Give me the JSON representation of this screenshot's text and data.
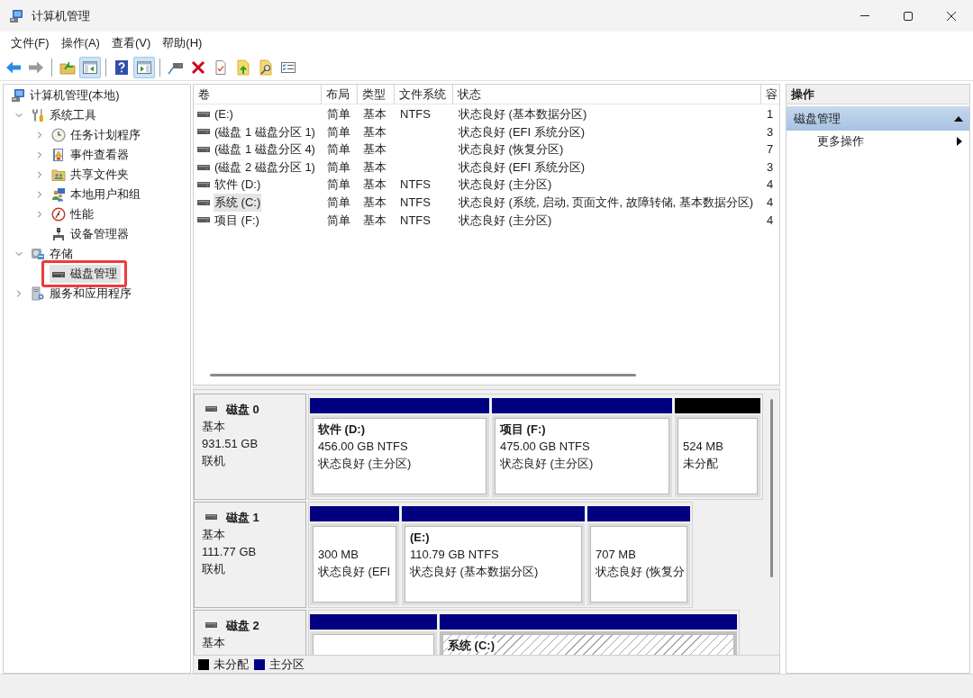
{
  "window": {
    "title": "计算机管理"
  },
  "menu": [
    "文件(F)",
    "操作(A)",
    "查看(V)",
    "帮助(H)"
  ],
  "toolbar": [
    {
      "buttons": [
        {
          "kind": "back",
          "disabled": false,
          "pressed": false
        },
        {
          "kind": "forward",
          "disabled": true,
          "pressed": false
        }
      ]
    },
    {
      "buttons": [
        {
          "kind": "up-folder",
          "disabled": false,
          "pressed": false
        },
        {
          "kind": "tree-toggle",
          "disabled": false,
          "pressed": true
        }
      ]
    },
    {
      "buttons": [
        {
          "kind": "help",
          "disabled": false,
          "pressed": false
        },
        {
          "kind": "pane-toggle",
          "disabled": false,
          "pressed": true
        }
      ]
    },
    {
      "buttons": [
        {
          "kind": "connect",
          "disabled": false,
          "pressed": false
        },
        {
          "kind": "delete",
          "disabled": false,
          "pressed": false
        },
        {
          "kind": "properties",
          "disabled": false,
          "pressed": false
        },
        {
          "kind": "export",
          "disabled": false,
          "pressed": false
        },
        {
          "kind": "search",
          "disabled": false,
          "pressed": false
        },
        {
          "kind": "list",
          "disabled": false,
          "pressed": false
        }
      ]
    }
  ],
  "tree": [
    {
      "label": "计算机管理(本地)",
      "kind": "computer",
      "selected": false,
      "marked": false,
      "children": [
        {
          "label": "系统工具",
          "kind": "tools",
          "expanded": true,
          "selected": false,
          "marked": false,
          "children": [
            {
              "label": "任务计划程序",
              "kind": "clock",
              "expanded": false,
              "selected": false,
              "marked": false
            },
            {
              "label": "事件查看器",
              "kind": "event-log",
              "expanded": false,
              "selected": false,
              "marked": false
            },
            {
              "label": "共享文件夹",
              "kind": "shared-folder",
              "expanded": false,
              "selected": false,
              "marked": false
            },
            {
              "label": "本地用户和组",
              "kind": "users",
              "expanded": false,
              "selected": false,
              "marked": false
            },
            {
              "label": "性能",
              "kind": "gauge",
              "expanded": false,
              "selected": false,
              "marked": false
            },
            {
              "label": "设备管理器",
              "kind": "device",
              "selected": false,
              "marked": false
            }
          ]
        },
        {
          "label": "存储",
          "kind": "storage",
          "expanded": true,
          "selected": false,
          "marked": false,
          "children": [
            {
              "label": "磁盘管理",
              "kind": "disk",
              "selected": true,
              "marked": true
            }
          ]
        },
        {
          "label": "服务和应用程序",
          "kind": "services",
          "expanded": false,
          "selected": false,
          "marked": false
        }
      ]
    }
  ],
  "volumes": {
    "columns": [
      "卷",
      "布局",
      "类型",
      "文件系统",
      "状态",
      "容"
    ],
    "rows": [
      {
        "volume": "(E:)",
        "layout": "简单",
        "type": "基本",
        "file_system": "NTFS",
        "status": "状态良好 (基本数据分区)",
        "column_6": "1",
        "selected": false
      },
      {
        "volume": "(磁盘 1 磁盘分区 1)",
        "layout": "简单",
        "type": "基本",
        "status": "状态良好 (EFI 系统分区)",
        "column_6": "3",
        "selected": false
      },
      {
        "volume": "(磁盘 1 磁盘分区 4)",
        "layout": "简单",
        "type": "基本",
        "status": "状态良好 (恢复分区)",
        "column_6": "7",
        "selected": false
      },
      {
        "volume": "(磁盘 2 磁盘分区 1)",
        "layout": "简单",
        "type": "基本",
        "status": "状态良好 (EFI 系统分区)",
        "column_6": "3",
        "selected": false
      },
      {
        "volume": "软件 (D:)",
        "layout": "简单",
        "type": "基本",
        "file_system": "NTFS",
        "status": "状态良好 (主分区)",
        "column_6": "4",
        "selected": false
      },
      {
        "volume": "系统 (C:)",
        "layout": "简单",
        "type": "基本",
        "file_system": "NTFS",
        "status": "状态良好 (系统, 启动, 页面文件, 故障转储, 基本数据分区)",
        "column_6": "4",
        "selected": true
      },
      {
        "volume": "项目 (F:)",
        "layout": "简单",
        "type": "基本",
        "file_system": "NTFS",
        "status": "状态良好 (主分区)",
        "column_6": "4",
        "selected": false
      }
    ]
  },
  "disks": [
    {
      "name": "磁盘 0",
      "type": "基本",
      "size": "931.51 GB",
      "status": "联机",
      "partitions": [
        {
          "kind": "primary",
          "label": "软件 (D:)",
          "size": "456.00 GB NTFS",
          "status": "状态良好 (主分区)",
          "selected": false
        },
        {
          "kind": "primary",
          "label": "项目 (F:)",
          "size": "475.00 GB NTFS",
          "status": "状态良好 (主分区)",
          "selected": false
        },
        {
          "kind": "unallocated",
          "size": "524 MB",
          "status": "未分配",
          "selected": false
        }
      ]
    },
    {
      "name": "磁盘 1",
      "type": "基本",
      "size": "111.77 GB",
      "status": "联机",
      "partitions": [
        {
          "kind": "primary",
          "size": "300 MB",
          "status": "状态良好 (EFI",
          "selected": false
        },
        {
          "kind": "primary",
          "label": "(E:)",
          "size": "110.79 GB NTFS",
          "status": "状态良好 (基本数据分区)",
          "selected": false
        },
        {
          "kind": "primary",
          "size": "707 MB",
          "status": "状态良好 (恢复分",
          "selected": false
        }
      ]
    },
    {
      "name": "磁盘 2",
      "type": "基本",
      "partitions": [
        {
          "kind": "primary",
          "selected": false
        },
        {
          "kind": "primary",
          "label": "系统 (C:)",
          "selected": true
        }
      ]
    }
  ],
  "legend": [
    {
      "label": "未分配",
      "color": "#000000"
    },
    {
      "label": "主分区",
      "color": "#000080"
    }
  ],
  "actions": {
    "title": "操作",
    "groups": [
      {
        "label": "磁盘管理",
        "expanded": true,
        "items": [
          {
            "label": "更多操作",
            "submenu": true
          }
        ]
      }
    ]
  }
}
